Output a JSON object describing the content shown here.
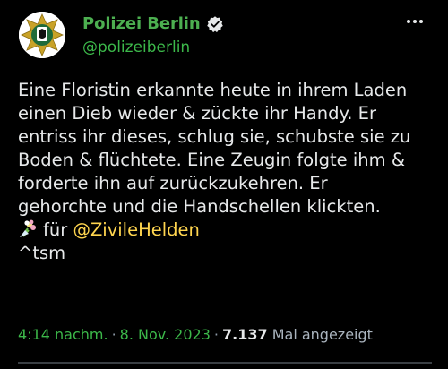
{
  "account": {
    "display_name": "Polizei Berlin",
    "handle": "@polizeiberlin",
    "verified": true,
    "avatar_icon": "police-star-badge-icon",
    "accent_color": "#4caf50"
  },
  "tweet": {
    "lines": [
      "Eine Floristin erkannte heute in ihrem Laden",
      "einen Dieb wieder & zückte ihr Handy. Er",
      "entriss ihr dieses, schlug sie, schubste sie zu",
      "Boden & flüchtete. Eine Zeugin folgte ihm &",
      "forderte ihn auf zurückzukehren. Er",
      "gehorchte und die Handschellen klickten."
    ],
    "thanks_icon": "bouquet-icon",
    "thanks_prefix": "für",
    "mention": "@ZivileHelden",
    "signature": "^tsm"
  },
  "meta": {
    "time": "4:14 nachm.",
    "date": "8. Nov. 2023",
    "views_count": "7.137",
    "views_label": "Mal angezeigt"
  },
  "more_icon": "more-options-icon"
}
